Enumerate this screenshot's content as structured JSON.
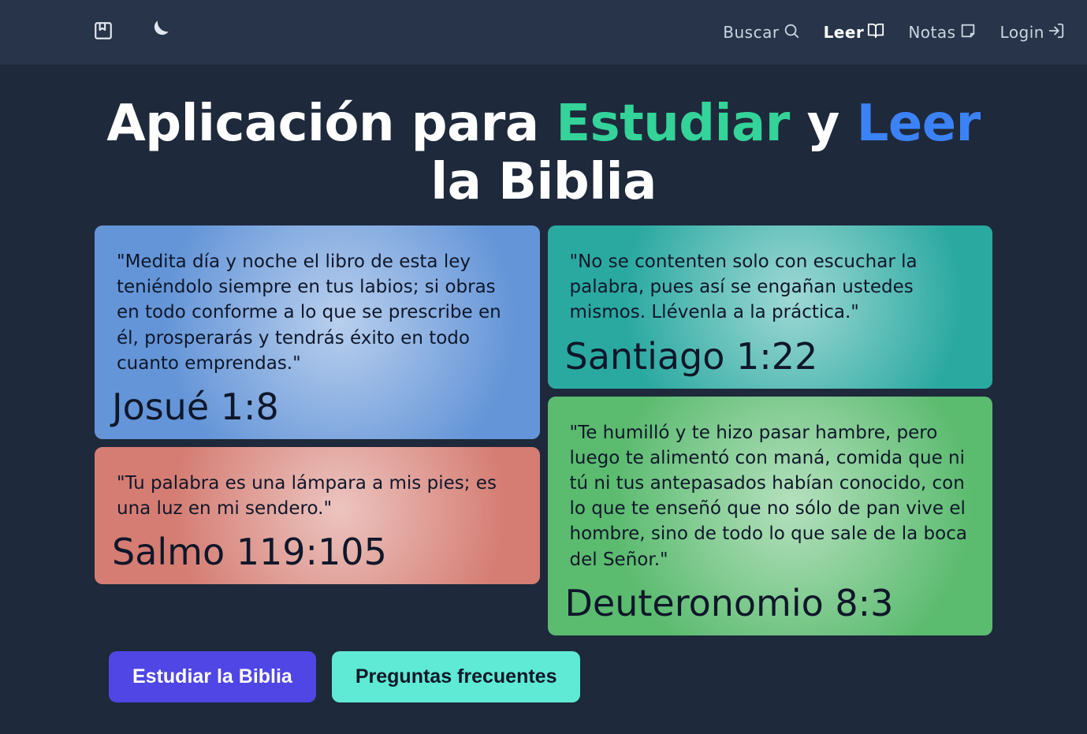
{
  "nav": {
    "search": "Buscar",
    "read": "Leer",
    "notes": "Notas",
    "login": "Login"
  },
  "title": {
    "part1": "Aplicación para ",
    "highlight1": "Estudiar",
    "part2": " y ",
    "highlight2": "Leer",
    "part3": " la Biblia"
  },
  "cards": {
    "left": [
      {
        "text": "\"Medita día y noche el libro de esta ley teniéndolo siempre en tus labios; si obras en todo conforme a lo que se prescribe en él, prosperarás y tendrás éxito en todo cuanto emprendas.\"",
        "ref": "Josué 1:8"
      },
      {
        "text": "\"Tu palabra es una lámpara a mis pies; es una luz en mi sendero.\"",
        "ref": "Salmo 119:105"
      }
    ],
    "right": [
      {
        "text": "\"No se contenten solo con escuchar la palabra, pues así se engañan ustedes mismos. Llévenla a la práctica.\"",
        "ref": "Santiago 1:22"
      },
      {
        "text": "\"Te humilló y te hizo pasar hambre, pero luego te alimentó con maná, comida que ni tú ni tus antepasados habían conocido, con lo que te enseñó que no sólo de pan vive el hombre, sino de todo lo que sale de la boca del Señor.\"",
        "ref": "Deuteronomio 8:3"
      }
    ]
  },
  "buttons": {
    "study": "Estudiar la Biblia",
    "faq": "Preguntas frecuentes"
  }
}
